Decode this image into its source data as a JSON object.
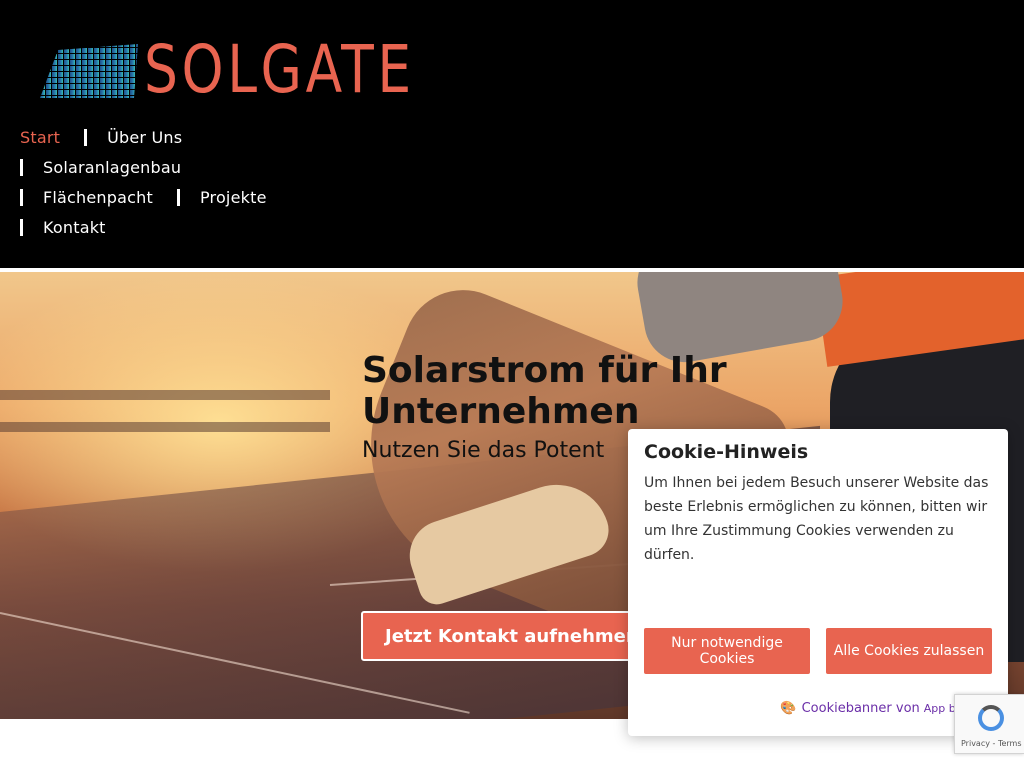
{
  "brand": {
    "name": "SOLGATE",
    "accent_color": "#e86450"
  },
  "nav": {
    "items": [
      {
        "label": "Start",
        "active": true
      },
      {
        "label": "Über Uns",
        "active": false
      },
      {
        "label": "Solaranlagenbau",
        "active": false
      },
      {
        "label": "Flächenpacht",
        "active": false
      },
      {
        "label": "Projekte",
        "active": false
      },
      {
        "label": "Kontakt",
        "active": false
      }
    ]
  },
  "hero": {
    "title": "Solarstrom für Ihr Unternehmen",
    "subtitle": "Nutzen Sie das Potent",
    "cta_label": "Jetzt Kontakt aufnehmen"
  },
  "cookie_banner": {
    "title": "Cookie-Hinweis",
    "text": "Um Ihnen bei jedem Besuch unserer Website das beste Erlebnis ermöglichen zu können, bitten wir um Ihre Zustimmung Cookies verwenden zu dürfen.",
    "necessary_label": "Nur notwendige Cookies",
    "accept_all_label": "Alle Cookies zulassen",
    "credit_text": "Cookiebanner von",
    "credit_brand": "App bis Web",
    "credit_color": "#6b2fa8"
  },
  "recaptcha": {
    "terms": "Privacy - Terms"
  }
}
